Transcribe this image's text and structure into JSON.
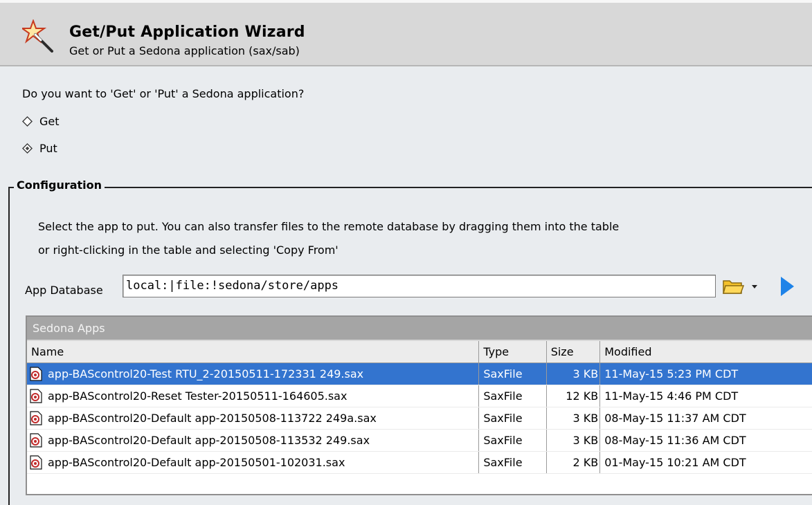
{
  "header": {
    "title": "Get/Put Application Wizard",
    "subtitle": "Get or Put a Sedona application (sax/sab)"
  },
  "question": "Do you want to 'Get' or 'Put' a Sedona application?",
  "options": [
    {
      "label": "Get",
      "selected": false
    },
    {
      "label": "Put",
      "selected": true
    }
  ],
  "configuration": {
    "legend": "Configuration",
    "description_line1": "Select the app to put. You can also transfer files to the remote database by dragging them into the table",
    "description_line2": "or right-clicking in the table and selecting 'Copy From'",
    "db_label": "App Database",
    "db_value": "local:|file:!sedona/store/apps"
  },
  "table": {
    "title": "Sedona Apps",
    "columns": [
      "Name",
      "Type",
      "Size",
      "Modified"
    ],
    "rows": [
      {
        "name": "app-BAScontrol20-Test RTU_2-20150511-172331 249.sax",
        "type": "SaxFile",
        "size": "3 KB",
        "modified": "11-May-15 5:23 PM CDT",
        "selected": true
      },
      {
        "name": "app-BAScontrol20-Reset Tester-20150511-164605.sax",
        "type": "SaxFile",
        "size": "12 KB",
        "modified": "11-May-15 4:46 PM CDT",
        "selected": false
      },
      {
        "name": "app-BAScontrol20-Default app-20150508-113722 249a.sax",
        "type": "SaxFile",
        "size": "3 KB",
        "modified": "08-May-15 11:37 AM CDT",
        "selected": false
      },
      {
        "name": "app-BAScontrol20-Default app-20150508-113532 249.sax",
        "type": "SaxFile",
        "size": "3 KB",
        "modified": "08-May-15 11:36 AM CDT",
        "selected": false
      },
      {
        "name": "app-BAScontrol20-Default app-20150501-102031.sax",
        "type": "SaxFile",
        "size": "2 KB",
        "modified": "01-May-15 10:21 AM CDT",
        "selected": false
      }
    ]
  },
  "icons": {
    "wizard": "magic-wand-icon",
    "radio": "diamond-radio-icon",
    "folder": "folder-icon",
    "go": "play-arrow-icon",
    "file": "sax-file-icon"
  },
  "colors": {
    "selection": "#3374cf",
    "header_bg": "#d8d8d8",
    "play": "#1e83e8",
    "folder": "#f4c12b"
  }
}
